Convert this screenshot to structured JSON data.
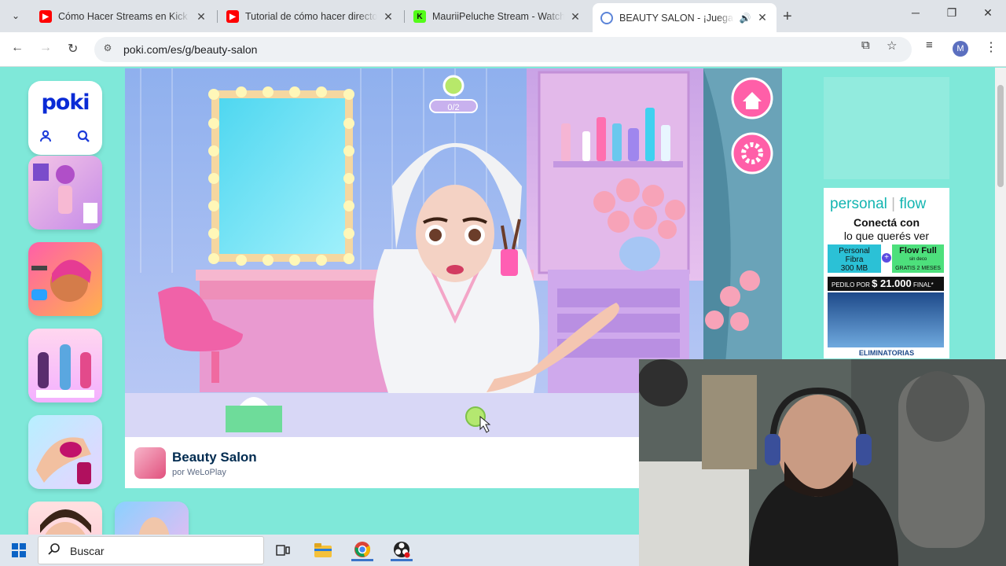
{
  "browser": {
    "tabs": [
      {
        "title": "Cómo Hacer Streams en Kick (C",
        "favicon": "youtube-icon",
        "active": false
      },
      {
        "title": "Tutorial de cómo hacer directos",
        "favicon": "youtube-icon",
        "active": false
      },
      {
        "title": "MauriiPeluche Stream - Watch I",
        "favicon": "kick-icon",
        "active": false
      },
      {
        "title": "BEAUTY SALON - ¡Juega Gr",
        "favicon": "poki-icon",
        "active": true
      }
    ],
    "url": "poki.com/es/g/beauty-salon",
    "profile_initial": "M"
  },
  "poki": {
    "logo": "poki",
    "game": {
      "progress": "0/2",
      "name": "Beauty Salon",
      "developer": "por WeLoPlay"
    }
  },
  "ad": {
    "brand_left": "personal",
    "brand_right": "flow",
    "headline_1": "Conectá con",
    "headline_2": "lo que querés ver",
    "plan_left_1": "Personal",
    "plan_left_2": "Fibra",
    "plan_left_3": "300 MB",
    "plan_right_1": "Flow Full",
    "plan_right_2": "sin deco",
    "plan_right_3": "GRATIS 2 MESES",
    "price_label": "PEDILO POR",
    "price_value": "$ 21.000",
    "price_suffix": "FINAL*",
    "footer": "ELIMINATORIAS"
  },
  "taskbar": {
    "search_placeholder": "Buscar"
  },
  "colors": {
    "page_bg": "#7fe8d9",
    "poki_blue": "#0a2bd6",
    "youtube_red": "#ff0000",
    "kick_green": "#53fc18",
    "game_pink": "#f06aa0"
  }
}
